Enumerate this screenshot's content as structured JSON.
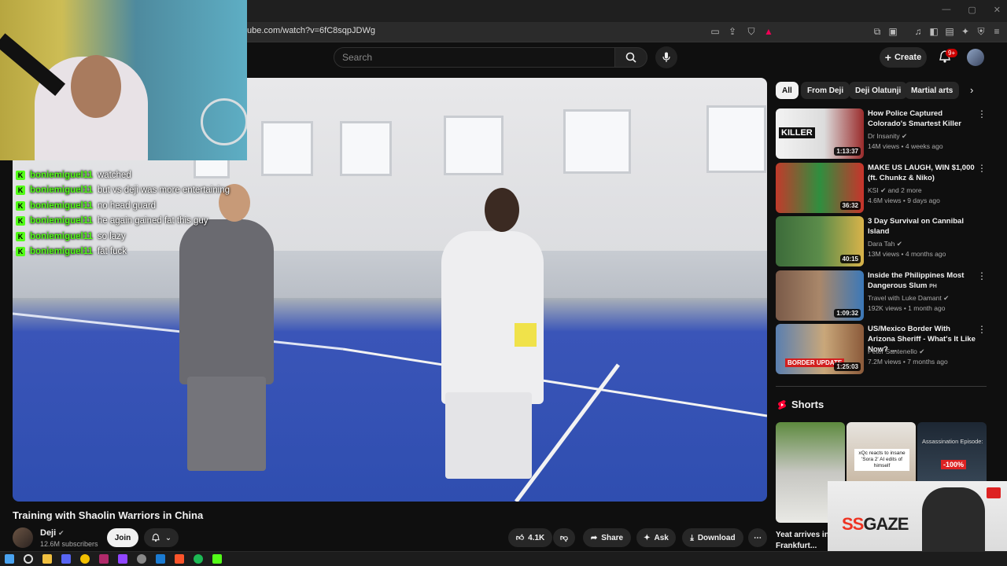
{
  "browser": {
    "url": "ube.com/watch?v=6fC8sqpJDWg"
  },
  "header": {
    "search_placeholder": "Search",
    "create_label": "Create",
    "notification_badge": "9+"
  },
  "chat": {
    "messages": [
      {
        "user": "boniemiguel11",
        "text": "watched"
      },
      {
        "user": "boniemiguel11",
        "text": "but vs deji was more entertaining"
      },
      {
        "user": "boniemiguel11",
        "text": "no head guard"
      },
      {
        "user": "boniemiguel11",
        "text": "he again gained fat this guy"
      },
      {
        "user": "boniemiguel11",
        "text": "so lazy"
      },
      {
        "user": "boniemiguel11",
        "text": "fat fuck"
      }
    ]
  },
  "video": {
    "title": "Training with Shaolin Warriors in China",
    "channel": "Deji",
    "subscribers": "12.6M subscribers",
    "join_label": "Join",
    "likes": "4.1K",
    "share_label": "Share",
    "ask_label": "Ask",
    "download_label": "Download"
  },
  "sidebar": {
    "chips": [
      "All",
      "From Deji",
      "Deji Olatunji",
      "Martial arts"
    ],
    "recommendations": [
      {
        "title": "How Police Captured Colorado's Smartest Killer",
        "channel": "Dr Insanity",
        "meta": "14M views • 4 weeks ago",
        "duration": "1:13:37",
        "thumb_text": "KILLER"
      },
      {
        "title": "MAKE US LAUGH, WIN $1,000 (ft. Chunkz & Niko)",
        "channel": "KSI",
        "channel_extra": "and 2 more",
        "meta": "4.6M views • 9 days ago",
        "duration": "36:32"
      },
      {
        "title": "3 Day Survival on Cannibal Island",
        "channel": "Dara Tah",
        "meta": "13M views • 4 months ago",
        "duration": "40:15"
      },
      {
        "title": "Inside the Philippines Most Dangerous Slum",
        "title_suffix": "PH",
        "channel": "Travel with Luke Damant",
        "meta": "192K views • 1 month ago",
        "duration": "1:09:32"
      },
      {
        "title": "US/Mexico Border With Arizona Sheriff - What's It Like Now? ...",
        "channel": "Peter Santenello",
        "meta": "7.2M views • 7 months ago",
        "duration": "1:25:03",
        "thumb_text": "BORDER UPDATE"
      }
    ],
    "shorts_label": "Shorts",
    "shorts": [
      {
        "title": "Yeat arrives in Frankfurt..."
      },
      {
        "caption": "xQc reacts to insane 'Sora 2' AI edits of himself"
      },
      {
        "caption": "Assassination Episode:",
        "tag": "-100%"
      }
    ]
  },
  "overlay": {
    "brand_prefix": "SS",
    "brand_suffix": "GAZE"
  },
  "colors": {
    "kick_green": "#53fc18",
    "background": "#0f0f0f",
    "notification_red": "#cc0000"
  }
}
